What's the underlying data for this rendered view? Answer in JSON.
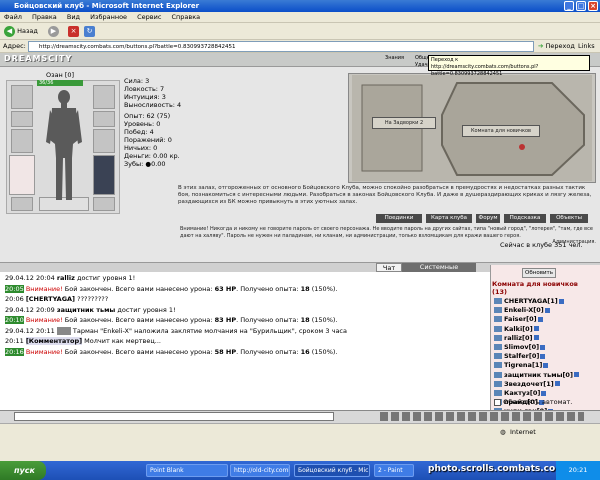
{
  "window": {
    "title": "Бойцовский клуб - Microsoft Internet Explorer"
  },
  "menu": [
    "Файл",
    "Правка",
    "Вид",
    "Избранное",
    "Сервис",
    "Справка"
  ],
  "toolbar": {
    "back": "Назад"
  },
  "address": {
    "label": "Адрес:",
    "url": "http://dreamscity.combats.com/buttons.pl?battle=0.830993728842451",
    "go": "Переход",
    "links": "Links"
  },
  "tooltip": {
    "line1": "Переход к",
    "line2": "http://dreamscity.combats.com/buttons.pl?battle=0.830993728842451"
  },
  "header": {
    "logo": "DREAMSCITY",
    "tabs": [
      "Знания",
      "Общение",
      "Удача"
    ]
  },
  "character": {
    "name": "Озан [0]",
    "hp": "36/36",
    "stats": [
      "Сила: 3",
      "Ловкость: 7",
      "Интуиция: 3",
      "Выносливость: 4"
    ],
    "info": [
      "Опыт: 62 (75)",
      "Уровень: 0",
      "Побед: 4",
      "Поражений: 0",
      "Ничьих: 0",
      "Деньги: 0.00 кр.",
      "Зубы: ●0.00"
    ]
  },
  "map": {
    "plaque_left": "На Задворки 2",
    "plaque_right": "Комната для новичков"
  },
  "description": "В этих залах, отгороженных от основного Бойцовского Клуба, можно спокойно разобраться в премудростях и недостатках разных тактик боя, познакомиться с интересными людьми. Разобраться в законах Бойцовского Клуба. И даже в душераздирающих криках и лязгу железа, раздающихся из БК можно привыкнуть в этих уютных залах.",
  "nav": [
    "Поединки",
    "Карта клуба",
    "Форум",
    "Подсказка",
    "Объекты"
  ],
  "warning": "Внимание! Никогда и никому не говорите пароль от своего персонажа. Не вводите пароль на других сайтах, типа \"новый город\", \"лотерея\", \"там, где все дают на халяву\". Пароль не нужен ни паладинам, ни кланам, ни администрации, только взломщикам для кражи вашего героя.",
  "admin": "Администрация.",
  "online": "Сейчас в клубе 351 чел.",
  "tabs": {
    "chat": "Чат",
    "system": "Системные сообщения"
  },
  "chat": [
    {
      "time": "29.04.12 20:04",
      "who": "ralliz",
      "text": " достиг уровня 1!"
    },
    {
      "time": "20:05",
      "green": true,
      "warn": "Внимание!",
      "text": " Бой закончен. Всего вами нанесено урона: ",
      "dmg": "63 HP",
      "rest": ". Получено опыта: ",
      "exp": "18",
      "end": " (150%)."
    },
    {
      "time": "20:06",
      "who": "[CHERTYAGA]",
      "text": " ?????????"
    },
    {
      "time": "29.04.12 20:09",
      "who": "защитник тьмы",
      "text": " достиг уровня 1!"
    },
    {
      "time": "20:10",
      "green": true,
      "warn": "Внимание!",
      "text": " Бой закончен. Всего вами нанесено урона: ",
      "dmg": "83 HP",
      "rest": ". Получено опыта: ",
      "exp": "18",
      "end": " (150%)."
    },
    {
      "time": "29.04.12 20:11",
      "text": " Тарман \"Enkeli-X\" наложила заклятие молчания на \"Бурильщик\", сроком 3 часа"
    },
    {
      "time": "20:11",
      "who": "[Комментатор]",
      "text": " Молчит как мертвец..."
    },
    {
      "time": "20:16",
      "green": true,
      "warn": "Внимание!",
      "text": " Бой закончен. Всего вами нанесено урона: ",
      "dmg": "58 HP",
      "rest": ". Получено опыта: ",
      "exp": "16",
      "end": " (150%)."
    }
  ],
  "room": {
    "refresh": "Обновить",
    "title": "Комната для новичков",
    "count": "(13)"
  },
  "users": [
    "CHERTYAGA[1]",
    "Enkeli-X[0]",
    "Faiser[0]",
    "Kalki[0]",
    "ralliz[0]",
    "Slimov[0]",
    "Stalfer[0]",
    "Tigrena[1]",
    "защитник тьмы[0]",
    "Звездочет[1]",
    "Кактуз[0]",
    "прайд[0]",
    "хули-ган[0]"
  ],
  "auto_update": "Обновлять автомат.",
  "status": {
    "zone": "Internet"
  },
  "taskbar": {
    "start": "пуск",
    "tasks": [
      "Point Blank",
      "http://old-city.combats",
      "Бойцовский клуб - Micro...",
      "2 - Paint"
    ],
    "clock": "20:21"
  },
  "watermark": "photo.scrolls.combats.com",
  "colors": {
    "titlebar": "#0b4ec9",
    "hp": "#3a9a3a",
    "warn": "#cc0000",
    "room_bg": "#f7e8e8"
  }
}
